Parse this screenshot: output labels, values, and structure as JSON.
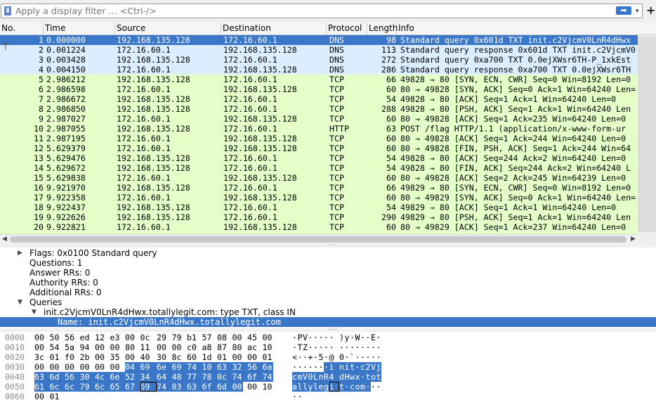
{
  "filter": {
    "placeholder": "Apply a display filter … <Ctrl-/>",
    "apply_glyph": "➡",
    "dropdown_glyph": "▾",
    "add_glyph": "+"
  },
  "columns": [
    "No.",
    "Time",
    "Source",
    "Destination",
    "Protocol",
    "Length",
    "Info"
  ],
  "row_colors": {
    "dns": "#daeeff",
    "tcp": "#e4ffc7",
    "selected": "#3b77c9"
  },
  "packets": [
    {
      "no": "1",
      "time": "0.000000",
      "src": "192.168.135.128",
      "dst": "172.16.60.1",
      "proto": "DNS",
      "len": "98",
      "info": "Standard query 0x601d TXT init.c2VjcmV0LnR4dHwx",
      "kind": "dns",
      "selected": true
    },
    {
      "no": "2",
      "time": "0.001224",
      "src": "172.16.60.1",
      "dst": "192.168.135.128",
      "proto": "DNS",
      "len": "113",
      "info": "Standard query response 0x601d TXT init.c2VjcmV0",
      "kind": "dns"
    },
    {
      "no": "3",
      "time": "0.003428",
      "src": "192.168.135.128",
      "dst": "172.16.60.1",
      "proto": "DNS",
      "len": "272",
      "info": "Standard query 0xa700 TXT 0.0ejXWsr6TH-P_1xkEst",
      "kind": "dns"
    },
    {
      "no": "4",
      "time": "0.004150",
      "src": "172.16.60.1",
      "dst": "192.168.135.128",
      "proto": "DNS",
      "len": "286",
      "info": "Standard query response 0xa700 TXT 0.0ejXWsr6TH",
      "kind": "dns"
    },
    {
      "no": "5",
      "time": "2.986212",
      "src": "192.168.135.128",
      "dst": "172.16.60.1",
      "proto": "TCP",
      "len": "66",
      "info": "49828 → 80 [SYN, ECN, CWR] Seq=0 Win=8192 Len=0",
      "kind": "tcp"
    },
    {
      "no": "6",
      "time": "2.986598",
      "src": "172.16.60.1",
      "dst": "192.168.135.128",
      "proto": "TCP",
      "len": "60",
      "info": "80 → 49828 [SYN, ACK] Seq=0 Ack=1 Win=64240 Len=",
      "kind": "tcp"
    },
    {
      "no": "7",
      "time": "2.986672",
      "src": "192.168.135.128",
      "dst": "172.16.60.1",
      "proto": "TCP",
      "len": "54",
      "info": "49828 → 80 [ACK] Seq=1 Ack=1 Win=64240 Len=0",
      "kind": "tcp"
    },
    {
      "no": "8",
      "time": "2.986850",
      "src": "192.168.135.128",
      "dst": "172.16.60.1",
      "proto": "TCP",
      "len": "288",
      "info": "49828 → 80 [PSH, ACK] Seq=1 Ack=1 Win=64240 Len",
      "kind": "tcp"
    },
    {
      "no": "9",
      "time": "2.987027",
      "src": "172.16.60.1",
      "dst": "192.168.135.128",
      "proto": "TCP",
      "len": "60",
      "info": "80 → 49828 [ACK] Seq=1 Ack=235 Win=64240 Len=0",
      "kind": "tcp"
    },
    {
      "no": "10",
      "time": "2.987055",
      "src": "192.168.135.128",
      "dst": "172.16.60.1",
      "proto": "HTTP",
      "len": "63",
      "info": "POST /flag HTTP/1.1  (application/x-www-form-ur",
      "kind": "tcp"
    },
    {
      "no": "11",
      "time": "2.987195",
      "src": "172.16.60.1",
      "dst": "192.168.135.128",
      "proto": "TCP",
      "len": "60",
      "info": "80 → 49828 [ACK] Seq=1 Ack=244 Win=64240 Len=0",
      "kind": "tcp"
    },
    {
      "no": "12",
      "time": "5.629379",
      "src": "172.16.60.1",
      "dst": "192.168.135.128",
      "proto": "TCP",
      "len": "60",
      "info": "80 → 49828 [FIN, PSH, ACK] Seq=1 Ack=244 Win=64",
      "kind": "tcp"
    },
    {
      "no": "13",
      "time": "5.629476",
      "src": "192.168.135.128",
      "dst": "172.16.60.1",
      "proto": "TCP",
      "len": "54",
      "info": "49828 → 80 [ACK] Seq=244 Ack=2 Win=64240 Len=0",
      "kind": "tcp"
    },
    {
      "no": "14",
      "time": "5.629672",
      "src": "192.168.135.128",
      "dst": "172.16.60.1",
      "proto": "TCP",
      "len": "54",
      "info": "49828 → 80 [FIN, ACK] Seq=244 Ack=2 Win=64240 L",
      "kind": "tcp"
    },
    {
      "no": "15",
      "time": "5.629838",
      "src": "172.16.60.1",
      "dst": "192.168.135.128",
      "proto": "TCP",
      "len": "60",
      "info": "80 → 49828 [ACK] Seq=2 Ack=245 Win=64239 Len=0",
      "kind": "tcp"
    },
    {
      "no": "16",
      "time": "9.921970",
      "src": "192.168.135.128",
      "dst": "172.16.60.1",
      "proto": "TCP",
      "len": "66",
      "info": "49829 → 80 [SYN, ECN, CWR] Seq=0 Win=8192 Len=0",
      "kind": "tcp"
    },
    {
      "no": "17",
      "time": "9.922358",
      "src": "172.16.60.1",
      "dst": "192.168.135.128",
      "proto": "TCP",
      "len": "60",
      "info": "80 → 49829 [SYN, ACK] Seq=0 Ack=1 Win=64240 Len=",
      "kind": "tcp"
    },
    {
      "no": "18",
      "time": "9.922437",
      "src": "192.168.135.128",
      "dst": "172.16.60.1",
      "proto": "TCP",
      "len": "54",
      "info": "49829 → 80 [ACK] Seq=1 Ack=1 Win=64240 Len=0",
      "kind": "tcp"
    },
    {
      "no": "19",
      "time": "9.922626",
      "src": "192.168.135.128",
      "dst": "172.16.60.1",
      "proto": "TCP",
      "len": "290",
      "info": "49829 → 80 [PSH, ACK] Seq=1 Ack=1 Win=64240 Len",
      "kind": "tcp"
    },
    {
      "no": "20",
      "time": "9.922821",
      "src": "172.16.60.1",
      "dst": "192.168.135.128",
      "proto": "TCP",
      "len": "60",
      "info": "80 → 49829 [ACK] Seq=1 Ack=237 Win=64240 Len=0",
      "kind": "tcp"
    }
  ],
  "details": [
    {
      "text": "Flags: 0x0100 Standard query",
      "level": 1,
      "twisty": "collapsed"
    },
    {
      "text": "Questions: 1",
      "level": 1,
      "twisty": "none"
    },
    {
      "text": "Answer RRs: 0",
      "level": 1,
      "twisty": "none"
    },
    {
      "text": "Authority RRs: 0",
      "level": 1,
      "twisty": "none"
    },
    {
      "text": "Additional RRs: 0",
      "level": 1,
      "twisty": "none"
    },
    {
      "text": "Queries",
      "level": 1,
      "twisty": "expanded"
    },
    {
      "text": "init.c2VjcmV0LnR4dHwx.totallylegit.com: type TXT, class IN",
      "level": 2,
      "twisty": "expanded"
    },
    {
      "text": "Name: init.c2VjcmV0LnR4dHwx.totallylegit.com",
      "level": 3,
      "twisty": "none",
      "selected": true
    }
  ],
  "bytes": [
    {
      "offset": "0000",
      "hex": [
        "00",
        "50",
        "56",
        "ed",
        "12",
        "e3",
        "00",
        "0c",
        "29",
        "79",
        "b1",
        "57",
        "08",
        "00",
        "45",
        "00"
      ],
      "ascii": [
        "·",
        "P",
        "V",
        "·",
        "·",
        "·",
        "·",
        "·",
        ")",
        "y",
        "·",
        "W",
        "·",
        "·",
        "E",
        "·"
      ]
    },
    {
      "offset": "0010",
      "hex": [
        "00",
        "54",
        "5a",
        "94",
        "00",
        "00",
        "80",
        "11",
        "00",
        "00",
        "c0",
        "a8",
        "87",
        "80",
        "ac",
        "10"
      ],
      "ascii": [
        "·",
        "T",
        "Z",
        "·",
        "·",
        "·",
        "·",
        "·",
        "·",
        "·",
        "·",
        "·",
        "·",
        "·",
        "·",
        "·"
      ]
    },
    {
      "offset": "0020",
      "hex": [
        "3c",
        "01",
        "f0",
        "2b",
        "00",
        "35",
        "00",
        "40",
        "30",
        "8c",
        "60",
        "1d",
        "01",
        "00",
        "00",
        "01"
      ],
      "ascii": [
        "<",
        "·",
        "·",
        "+",
        "·",
        "5",
        "·",
        "@",
        "0",
        "·",
        "`",
        "·",
        "·",
        "·",
        "·",
        "·"
      ]
    },
    {
      "offset": "0030",
      "hex": [
        "00",
        "00",
        "00",
        "00",
        "00",
        "00",
        "04",
        "69",
        "6e",
        "69",
        "74",
        "10",
        "63",
        "32",
        "56",
        "6a"
      ],
      "ascii": [
        "·",
        "·",
        "·",
        "·",
        "·",
        "·",
        "·",
        "i",
        "n",
        "i",
        "t",
        "·",
        "c",
        "2",
        "V",
        "j"
      ]
    },
    {
      "offset": "0040",
      "hex": [
        "63",
        "6d",
        "56",
        "30",
        "4c",
        "6e",
        "52",
        "34",
        "64",
        "48",
        "77",
        "78",
        "0c",
        "74",
        "6f",
        "74"
      ],
      "ascii": [
        "c",
        "m",
        "V",
        "0",
        "L",
        "n",
        "R",
        "4",
        "d",
        "H",
        "w",
        "x",
        "·",
        "t",
        "o",
        "t"
      ]
    },
    {
      "offset": "0050",
      "hex": [
        "61",
        "6c",
        "6c",
        "79",
        "6c",
        "65",
        "67",
        "69",
        "74",
        "03",
        "63",
        "6f",
        "6d",
        "00",
        "00",
        "10"
      ],
      "ascii": [
        "a",
        "l",
        "l",
        "y",
        "l",
        "e",
        "g",
        "i",
        "t",
        "·",
        "c",
        "o",
        "m",
        "·",
        "·",
        "·"
      ]
    },
    {
      "offset": "0060",
      "hex": [
        "00",
        "01"
      ],
      "ascii": [
        "·",
        "·"
      ]
    }
  ],
  "selection": {
    "start": 54,
    "end": 93,
    "cursor": 87
  }
}
